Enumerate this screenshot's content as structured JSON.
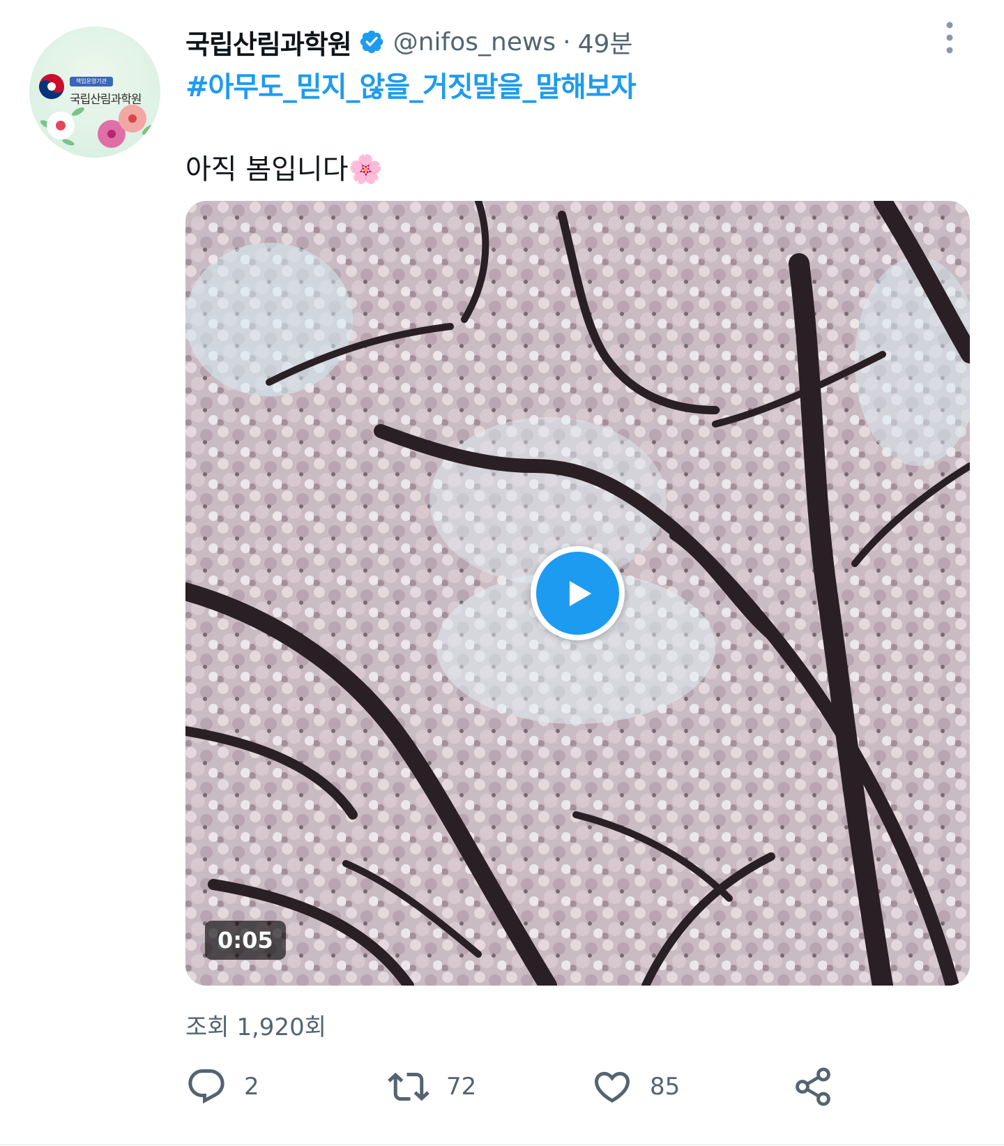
{
  "account": {
    "display_name": "국립산림과학원",
    "handle": "@nifos_news",
    "separator": "·",
    "time": "49분",
    "verified": true,
    "avatar_badge": "책임운영기관",
    "avatar_org_name": "국립산림과학원"
  },
  "tweet": {
    "hashtag": "#아무도_믿지_않을_거짓말을_말해보자",
    "text": "아직 봄입니다🌸"
  },
  "media": {
    "type": "video",
    "duration": "0:05"
  },
  "stats": {
    "views": "조회 1,920회"
  },
  "actions": {
    "reply_count": "2",
    "retweet_count": "72",
    "like_count": "85"
  },
  "icons": {
    "verified": "verified-badge-icon",
    "more": "more-vertical-icon",
    "play": "play-icon",
    "reply": "reply-icon",
    "retweet": "retweet-icon",
    "like": "heart-icon",
    "share": "share-icon"
  },
  "colors": {
    "accent": "#1d9bf0",
    "text_primary": "#0f1419",
    "text_secondary": "#536471"
  }
}
